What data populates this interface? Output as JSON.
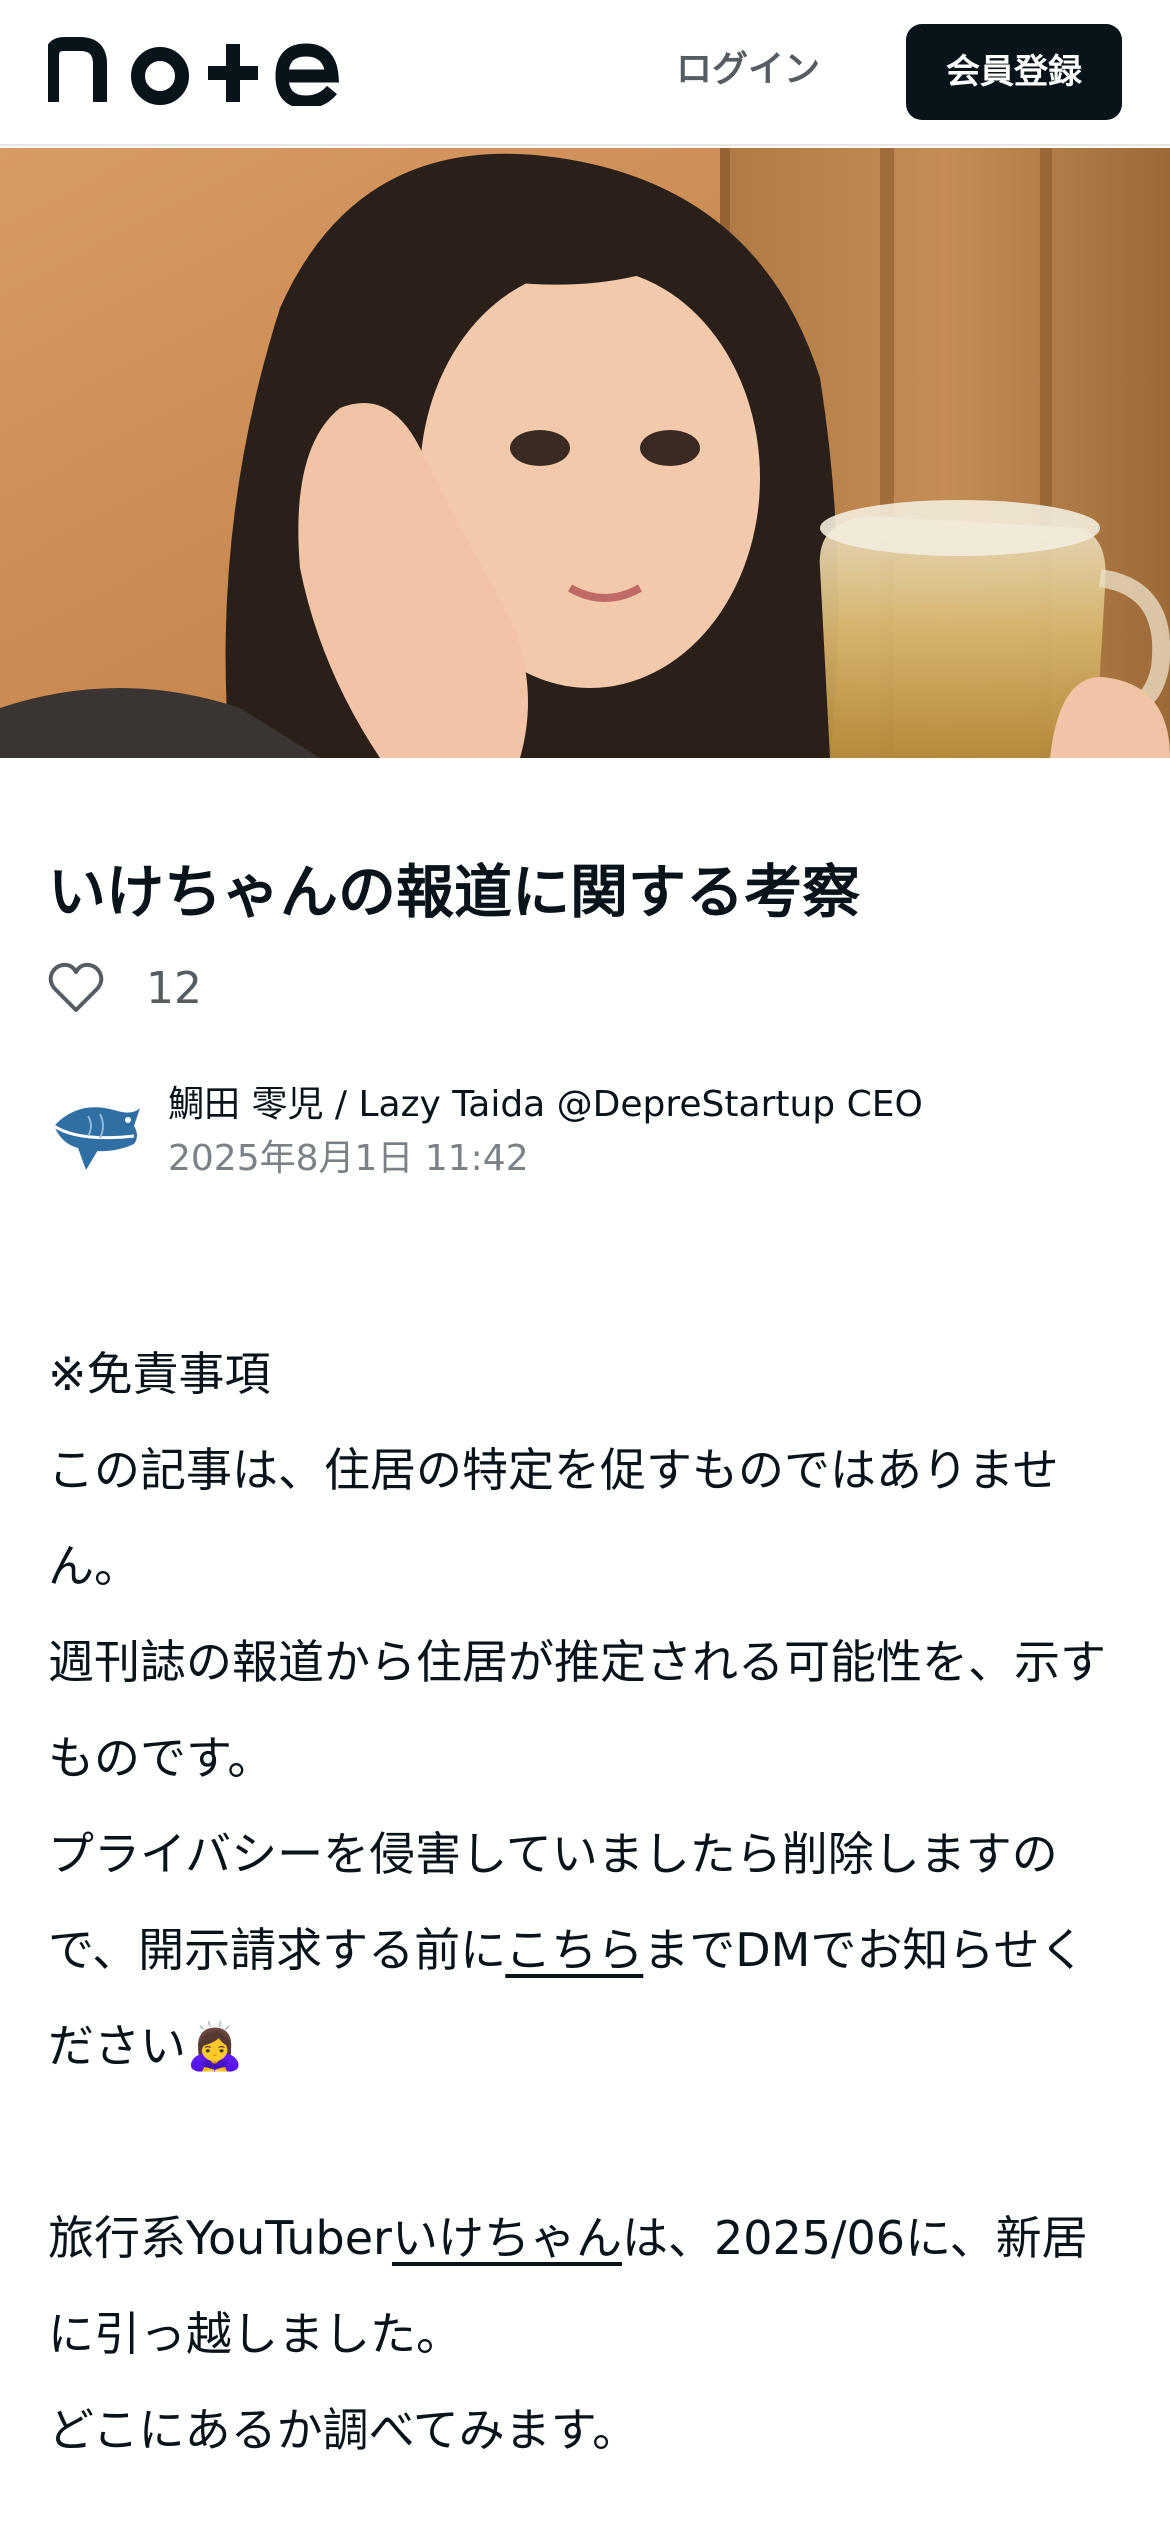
{
  "header": {
    "logo_text": "note",
    "login_label": "ログイン",
    "signup_label": "会員登録"
  },
  "article": {
    "title": "いけちゃんの報道に関する考察",
    "likes": "12",
    "author_name": "鯛田 零児 / Lazy Taida @DepreStartup CEO",
    "date": "2025年8月1日 11:42",
    "body": {
      "disclaimer_heading": "※免責事項",
      "p1": "この記事は、住居の特定を促すものではありません。",
      "p2": "週刊誌の報道から住居が推定される可能性を、示すものです。",
      "p3_before": "プライバシーを侵害していましたら削除しますので、開示請求する前に",
      "p3_link": "こちら",
      "p3_after": "までDMでお知らせください🙇‍♀️",
      "p4_before": "旅行系YouTuber",
      "p4_link": "いけちゃん",
      "p4_after": "は、2025/06に、新居に引っ越しました。",
      "p5": "どこにあるか調べてみます。"
    }
  },
  "colors": {
    "text": "#08131a",
    "muted": "#555d62",
    "date": "#7b8287",
    "button_bg": "#08131a"
  }
}
